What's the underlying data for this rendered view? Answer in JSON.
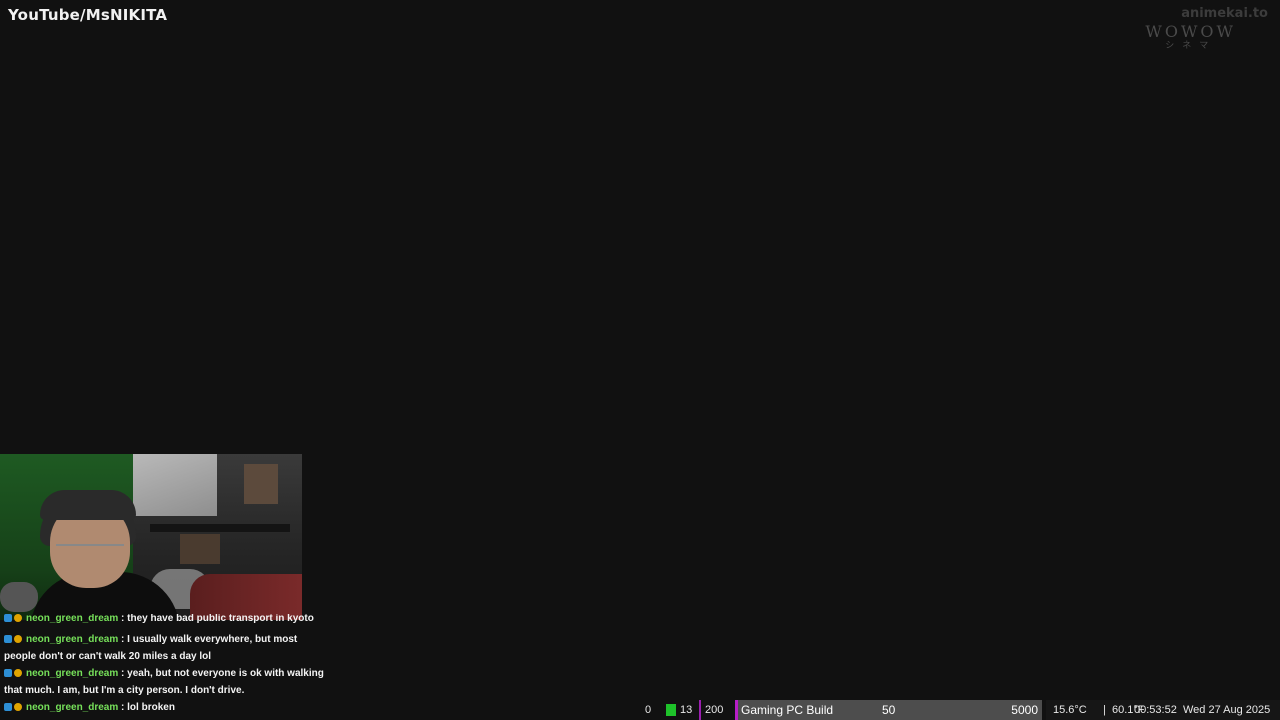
{
  "overlay": {
    "channel_watermark": "YouTube/MsNIKITA",
    "site_watermark": "animekai.to",
    "broadcaster_logo": "WOWOW",
    "broadcaster_sub": "シネマ"
  },
  "chat": {
    "messages": [
      {
        "user": "neon_green_dream",
        "text": " : they have bad public transport in kyoto"
      },
      {
        "user": "neon_green_dream",
        "text": " : I usually walk everywhere, but most people don't or can't walk 20 miles a day lol"
      },
      {
        "user": "neon_green_dream",
        "text": " : yeah, but not everyone is ok with walking that much. I am, but I'm a city person. I don't drive."
      },
      {
        "user": "neon_green_dream",
        "text": " : lol broken"
      }
    ]
  },
  "statusbar": {
    "count_zero": "0",
    "badge_count": "13",
    "bar_count": "200",
    "goal": {
      "label": "Gaming PC Build",
      "current": "50",
      "target": "5000",
      "progress_fraction": 0.01,
      "accent_color": "#b61ec6"
    },
    "temperature_c": "15.6°C",
    "separator": "|",
    "temperature_f": "60.1°F",
    "time": "00:53:52",
    "date": "Wed 27 Aug 2025"
  },
  "colors": {
    "background": "#111111",
    "username": "#76e05a",
    "badge_green": "#1ec22a",
    "bar_purple": "#9b1fb0"
  }
}
